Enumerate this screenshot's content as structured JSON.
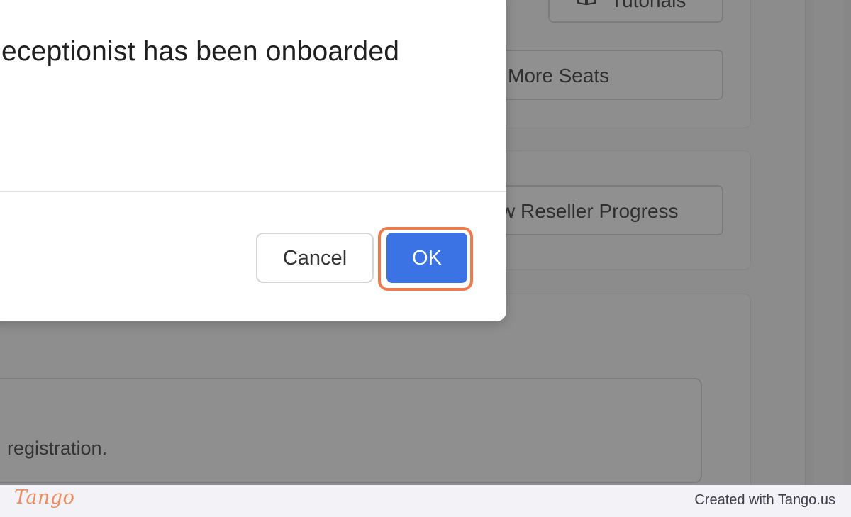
{
  "background": {
    "tutorials_label": "Tutorials",
    "seats_label": "More Seats",
    "reseller_label": "w Reseller Progress",
    "registration_text": "registration."
  },
  "modal": {
    "title": "eceptionist has been onboarded",
    "cancel_label": "Cancel",
    "ok_label": "OK"
  },
  "footer": {
    "logo_text": "Tango",
    "credit": "Created with Tango.us"
  },
  "colors": {
    "ok_button": "#3b73e5",
    "highlight": "#f07a4c",
    "logo": "#f08a5d"
  }
}
